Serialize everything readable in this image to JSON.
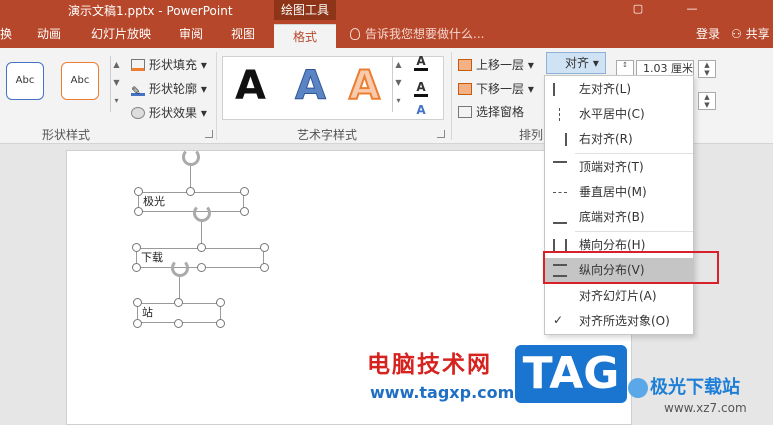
{
  "titlebar": {
    "doc_title": "演示文稿1.pptx - PowerPoint",
    "context_tab": "绘图工具",
    "restore_icon": "restore-window-icon",
    "minimize_label": "—"
  },
  "tabs": {
    "items": [
      "换",
      "动画",
      "幻灯片放映",
      "审阅",
      "视图",
      "格式"
    ],
    "active": "格式",
    "tellme": "告诉我您想要做什么...",
    "login": "登录",
    "share": "共享"
  },
  "ribbon": {
    "shape_styles": {
      "preset1": "Abc",
      "preset2": "Abc",
      "fill": "形状填充",
      "outline": "形状轮廓",
      "effects": "形状效果",
      "group_label": "形状样式"
    },
    "wordart": {
      "letter": "A",
      "group_label": "艺术字样式"
    },
    "arrange": {
      "bring_forward": "上移一层",
      "send_backward": "下移一层",
      "selection_pane": "选择窗格",
      "align_button": "对齐",
      "group_label": "排列"
    },
    "size": {
      "height_value": "1.03 厘米"
    }
  },
  "slide": {
    "shape1_text": "极光",
    "shape2_text": "下载",
    "shape3_text": "站"
  },
  "align_menu": {
    "items": [
      {
        "label": "左对齐(L)",
        "icon": "align-left-icon"
      },
      {
        "label": "水平居中(C)",
        "icon": "align-center-icon"
      },
      {
        "label": "右对齐(R)",
        "icon": "align-right-icon"
      },
      {
        "label": "顶端对齐(T)",
        "icon": "align-top-icon"
      },
      {
        "label": "垂直居中(M)",
        "icon": "align-middle-icon"
      },
      {
        "label": "底端对齐(B)",
        "icon": "align-bottom-icon"
      },
      {
        "label": "横向分布(H)",
        "icon": "distribute-horizontal-icon"
      },
      {
        "label": "纵向分布(V)",
        "icon": "distribute-vertical-icon"
      },
      {
        "label": "对齐幻灯片(A)",
        "icon": ""
      },
      {
        "label": "对齐所选对象(O)",
        "icon": "checkmark-icon"
      }
    ],
    "highlighted": "纵向分布(V)"
  },
  "watermarks": {
    "site_cn": "电脑技术网",
    "site_url": "www.tagxp.com",
    "tag": "TAG",
    "brand": "极光下载站",
    "brand_url": "www.xz7.com"
  },
  "colors": {
    "accent": "#b7472a",
    "highlight": "#c5c5c5",
    "callout": "#d8202a"
  }
}
